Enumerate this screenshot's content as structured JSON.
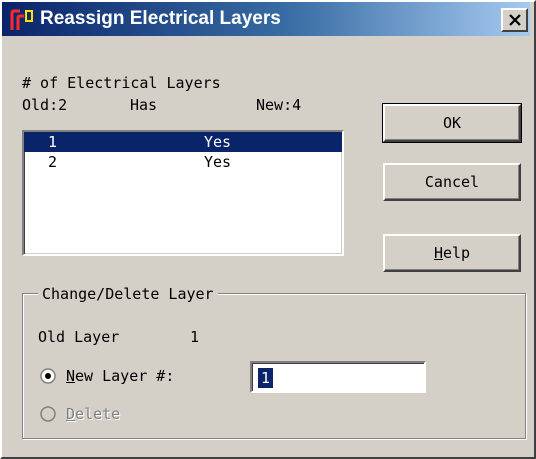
{
  "window": {
    "title": "Reassign Electrical Layers",
    "close_symbol": "×"
  },
  "info": {
    "heading": "# of Electrical Layers",
    "old_label": "Old:2",
    "has_label": "Has",
    "new_label": "New:4"
  },
  "layers": [
    {
      "number": "1",
      "has": "Yes",
      "selected": true
    },
    {
      "number": "2",
      "has": "Yes",
      "selected": false
    }
  ],
  "buttons": {
    "ok": "OK",
    "cancel": "Cancel",
    "help_accel": "H",
    "help_rest": "elp"
  },
  "group": {
    "title": "Change/Delete Layer",
    "old_layer_label": "Old Layer",
    "old_layer_value": "1",
    "new_layer_accel": "N",
    "new_layer_rest": "ew Layer #:",
    "new_layer_value": "1",
    "new_layer_selected": true,
    "delete_accel": "D",
    "delete_rest": "elete",
    "delete_enabled": false
  },
  "icons": {
    "app": "app-logo-icon",
    "close": "close-icon",
    "radio_on": "radio-selected-icon",
    "radio_off": "radio-unselected-icon"
  },
  "colors": {
    "face": "#d4d0c8",
    "title_start": "#0a246a",
    "title_end": "#a6caf0",
    "selection": "#0a246a",
    "disabled_text": "#808080"
  }
}
